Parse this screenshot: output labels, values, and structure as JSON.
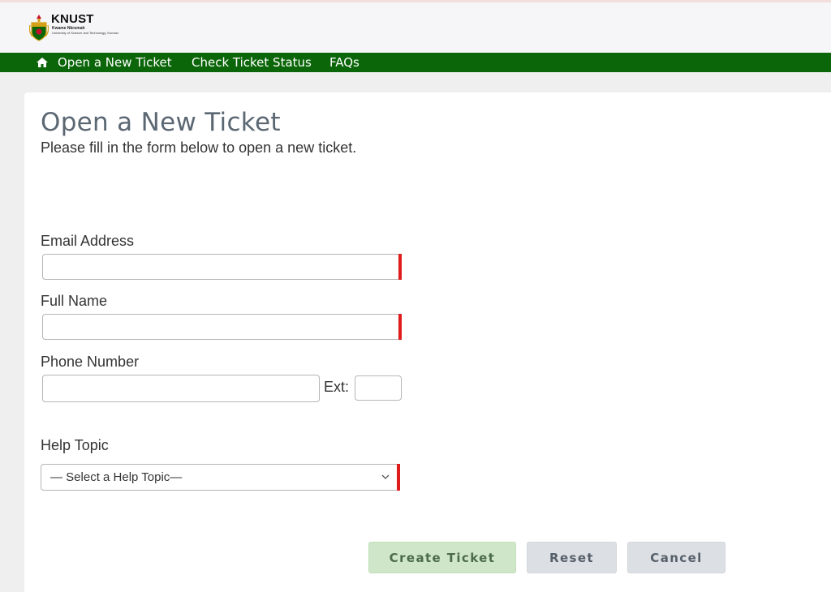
{
  "header": {
    "logo": {
      "name": "KNUST",
      "line1": "Kwame Nkrumah",
      "line2": "University of Science and Technology, Kumasi"
    }
  },
  "nav": {
    "home_icon": "home-icon",
    "items": [
      {
        "label": "Open a New Ticket"
      },
      {
        "label": "Check Ticket Status"
      },
      {
        "label": "FAQs"
      }
    ]
  },
  "page": {
    "title": "Open a New Ticket",
    "subtitle": "Please fill in the form below to open a new ticket."
  },
  "form": {
    "email": {
      "label": "Email Address",
      "value": ""
    },
    "full_name": {
      "label": "Full Name",
      "value": ""
    },
    "phone": {
      "label": "Phone Number",
      "value": "",
      "ext_label": "Ext:",
      "ext_value": ""
    },
    "help_topic": {
      "label": "Help Topic",
      "selected": "— Select a Help Topic—"
    }
  },
  "buttons": {
    "create": "Create Ticket",
    "reset": "Reset",
    "cancel": "Cancel"
  },
  "colors": {
    "nav_bg": "#0b6609",
    "required_marker": "#e01b1b",
    "create_button_bg": "#cfe7c8"
  }
}
